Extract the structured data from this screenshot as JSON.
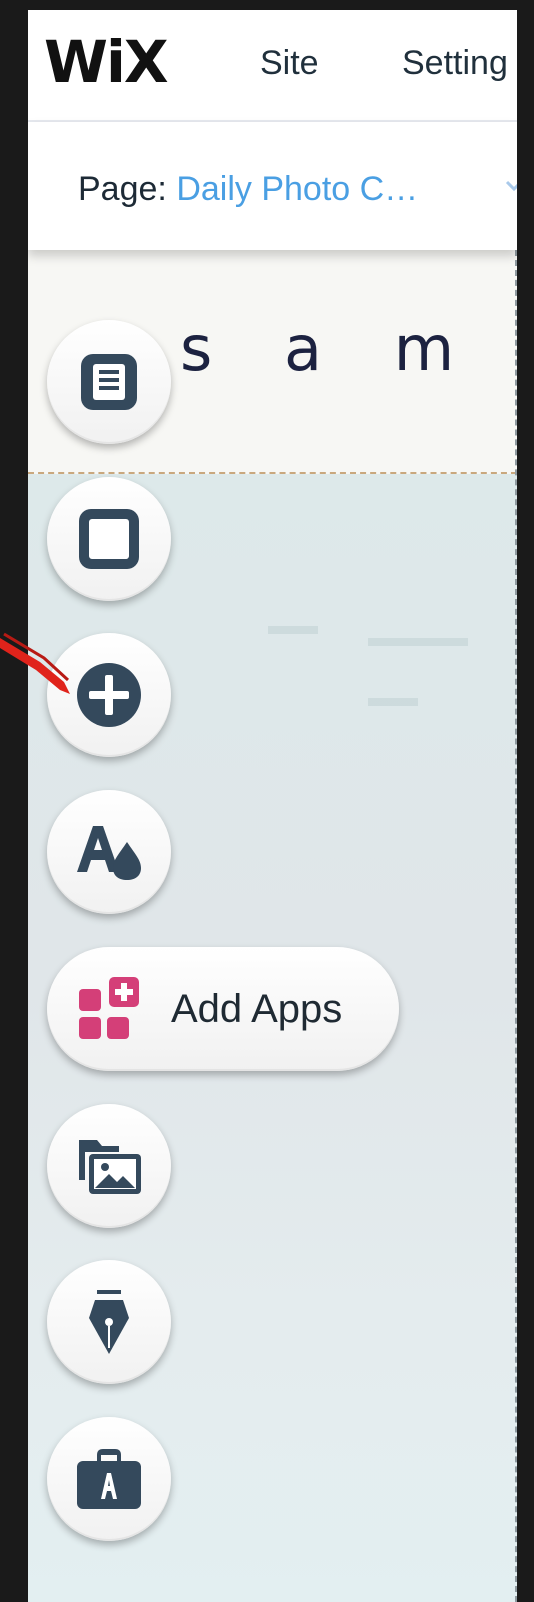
{
  "topbar": {
    "logo": "WiX",
    "menu": [
      "Site",
      "Setting"
    ]
  },
  "pagebar": {
    "label": "Page:",
    "page_name": "Daily Photo C…"
  },
  "canvas": {
    "header_text": "s a m p l"
  },
  "tools": {
    "pages_icon": "pages-icon",
    "background_icon": "background-icon",
    "add_icon": "add-plus-icon",
    "design_icon": "design-icon",
    "apps_label": "Add Apps",
    "apps_icon": "add-apps-icon",
    "media_icon": "my-uploads-icon",
    "blog_icon": "blog-pen-icon",
    "market_icon": "app-market-icon"
  },
  "colors": {
    "icon_dark": "#34495c",
    "apps_accent": "#d43f78",
    "link_blue": "#4a9fe3",
    "pointer_red": "#e0231b"
  }
}
